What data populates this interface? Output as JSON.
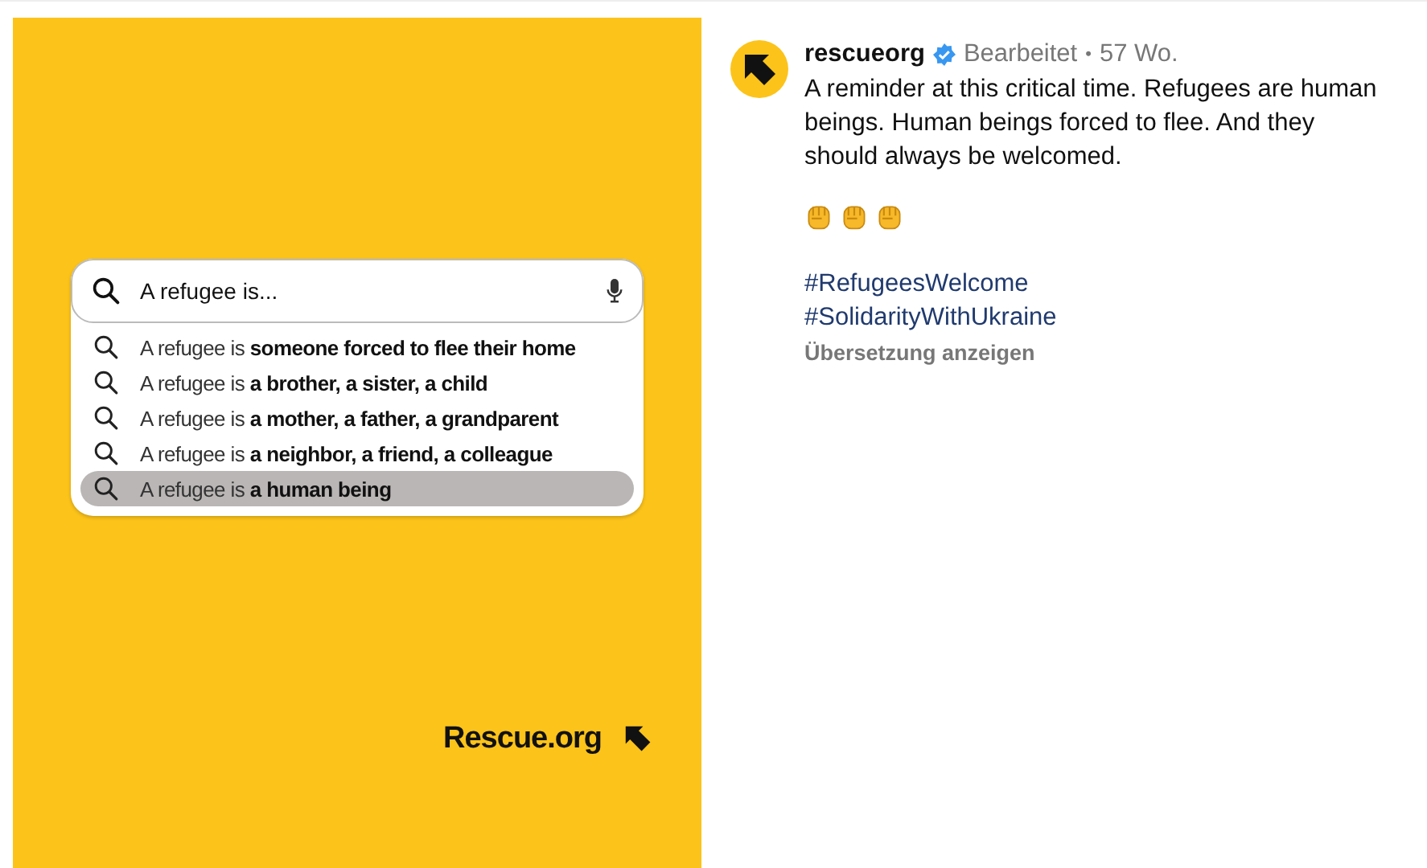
{
  "post_image": {
    "search": {
      "value": "A refugee is..."
    },
    "suggestions": [
      {
        "text": "A refugee is **someone forced to flee their home**",
        "selected": false
      },
      {
        "text": "A refugee is **a brother, a sister, a child**",
        "selected": false
      },
      {
        "text": "A refugee is **a mother, a father, a grandparent**",
        "selected": false
      },
      {
        "text": "A refugee is **a neighbor, a friend, a colleague**",
        "selected": false
      },
      {
        "text": "A refugee is **a human being**",
        "selected": true
      }
    ],
    "brand": "Rescue.org"
  },
  "caption": {
    "username": "rescueorg",
    "verified": true,
    "edited": "Bearbeitet",
    "separator": "•",
    "age": "57 Wo.",
    "text": "A reminder at this critical time. Refugees are human beings. Human beings forced to flee. And they should always be welcomed.",
    "emojis": [
      {
        "kind": "fist"
      },
      {
        "kind": "fist"
      },
      {
        "kind": "fist"
      }
    ],
    "hashtags": [
      "#RefugeesWelcome",
      "#SolidarityWithUkraine"
    ],
    "translate": "Übersetzung anzeigen"
  }
}
